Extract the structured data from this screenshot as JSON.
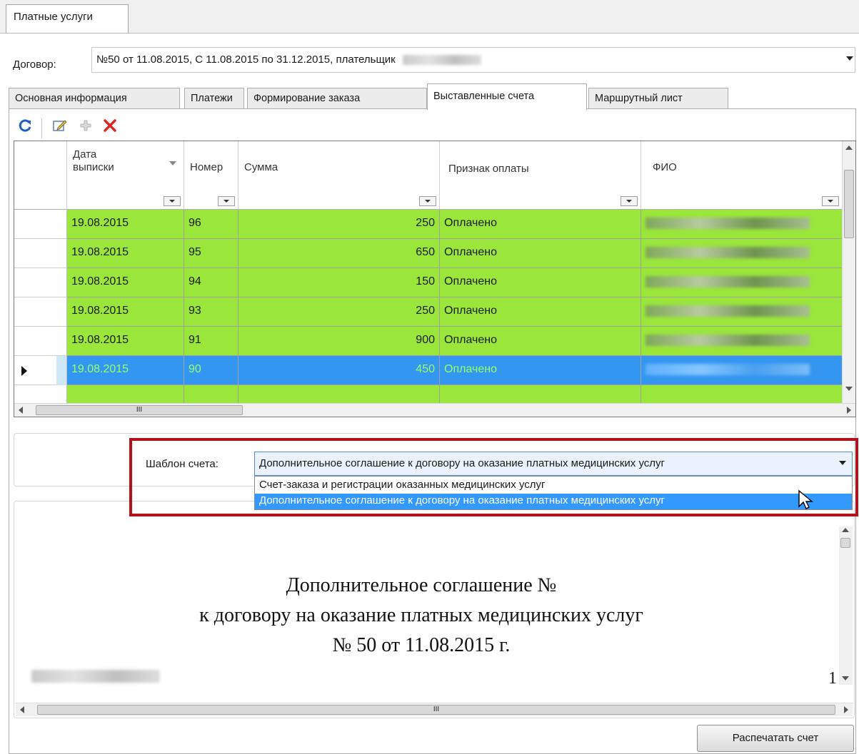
{
  "top_tab": {
    "label": "Платные услуги"
  },
  "contract": {
    "label": "Договор:",
    "value": "№50 от 11.08.2015, С 11.08.2015 по 31.12.2015, плательщик"
  },
  "tabs": [
    {
      "label": "Основная информация"
    },
    {
      "label": "Платежи"
    },
    {
      "label": "Формирование заказа"
    },
    {
      "label": "Выставленные счета"
    },
    {
      "label": "Маршрутный лист"
    }
  ],
  "toolbar": {
    "refresh_icon": "refresh-icon",
    "edit_icon": "edit-icon",
    "add_icon": "add-icon",
    "delete_icon": "delete-icon"
  },
  "grid": {
    "columns": {
      "date": "Дата выписки",
      "number": "Номер",
      "sum": "Сумма",
      "paid": "Признак оплаты",
      "fio": "ФИО"
    },
    "rows": [
      {
        "date": "19.08.2015",
        "number": "96",
        "sum": "250",
        "paid": "Оплачено"
      },
      {
        "date": "19.08.2015",
        "number": "95",
        "sum": "650",
        "paid": "Оплачено"
      },
      {
        "date": "19.08.2015",
        "number": "94",
        "sum": "150",
        "paid": "Оплачено"
      },
      {
        "date": "19.08.2015",
        "number": "93",
        "sum": "250",
        "paid": "Оплачено"
      },
      {
        "date": "19.08.2015",
        "number": "91",
        "sum": "900",
        "paid": "Оплачено"
      },
      {
        "date": "19.08.2015",
        "number": "90",
        "sum": "450",
        "paid": "Оплачено"
      }
    ],
    "h_scroll_label": "III"
  },
  "template": {
    "label": "Шаблон счета:",
    "selected": "Дополнительное соглашение к договору на оказание платных медицинских услуг",
    "options": [
      "Счет-заказа и регистрации оказанных медицинских услуг",
      "Дополнительное соглашение к договору на оказание платных медицинских услуг"
    ]
  },
  "preview": {
    "line1": "Дополнительное соглашение №",
    "line2": "к договору на оказание платных медицинских услуг",
    "line3": "№ 50 от 11.08.2015 г.",
    "page_num": "1",
    "h_scroll_label": "III"
  },
  "print_button": {
    "label": "Распечатать счет"
  },
  "colors": {
    "paid_row": "#9ae63a",
    "selected_row": "#3396f0",
    "highlight_frame": "#b3121b"
  }
}
